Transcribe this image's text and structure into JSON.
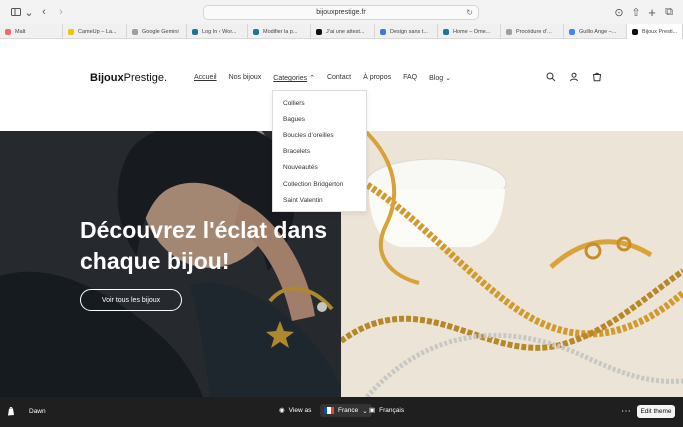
{
  "browser": {
    "url": "bijouxprestige.fr",
    "bookmarks": [
      {
        "label": "Malt",
        "color": "#f06a6a"
      },
      {
        "label": "CameUp – La...",
        "color": "#f0c400"
      },
      {
        "label": "Google Gemini",
        "color": "#9aa0a6"
      },
      {
        "label": "Log In ‹ Wor...",
        "color": "#21759b"
      },
      {
        "label": "Modifier la p...",
        "color": "#21759b"
      },
      {
        "label": "J’ai une attest...",
        "color": "#111111"
      },
      {
        "label": "Design sans t...",
        "color": "#3a7bd5"
      },
      {
        "label": "Home – Ome...",
        "color": "#21759b"
      },
      {
        "label": "Procédure d’...",
        "color": "#9aa0a6"
      },
      {
        "label": "Guillo Ange –...",
        "color": "#4285f4"
      },
      {
        "label": "Bijoux Presti...",
        "color": "#111111"
      }
    ]
  },
  "site": {
    "logo": {
      "bold": "Bijoux",
      "light": "Prestige."
    },
    "nav": [
      "Accueil",
      "Nos bijoux",
      "Categories",
      "Contact",
      "À propos",
      "FAQ",
      "Blog"
    ],
    "categories": [
      "Colliers",
      "Bagues",
      "Boucles d’oreilles",
      "Bracelets",
      "Nouveautés",
      "Collection Bridgerton",
      "Saint Valentin"
    ],
    "hero": {
      "title_line1": "Découvrez l'éclat dans",
      "title_line2": "chaque bijou!",
      "cta": "Voir tous les bijoux"
    }
  },
  "theme_bar": {
    "theme": "Dawn",
    "view_as": "View as",
    "country": "France",
    "language": "Français",
    "edit": "Edit theme"
  },
  "colors": {
    "bar_dark": "#1f1f1f",
    "gold": "#d4a63a"
  },
  "icons": [
    "sidebar-icon",
    "back-icon",
    "forward-icon",
    "reload-icon",
    "download-icon",
    "share-icon",
    "new-tab-icon",
    "tab-overview-icon",
    "search-icon",
    "account-icon",
    "cart-icon",
    "shopify-icon",
    "eye-icon",
    "globe-icon",
    "more-icon"
  ]
}
